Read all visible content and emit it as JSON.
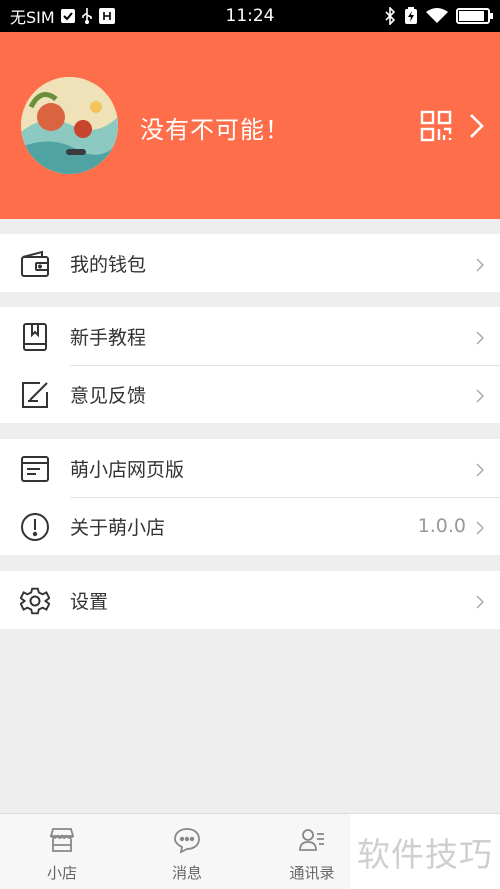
{
  "status_bar": {
    "carrier": "无SIM",
    "time": "11:24",
    "battery_level": 0.9
  },
  "profile": {
    "username": "没有不可能！",
    "qr_icon": "qr-code-icon",
    "chevron_icon": "chevron-right-icon"
  },
  "menu": {
    "wallet": {
      "label": "我的钱包",
      "icon": "wallet-icon"
    },
    "tutorial": {
      "label": "新手教程",
      "icon": "book-icon"
    },
    "feedback": {
      "label": "意见反馈",
      "icon": "edit-icon"
    },
    "web_version": {
      "label": "萌小店网页版",
      "icon": "browser-icon"
    },
    "about": {
      "label": "关于萌小店",
      "icon": "info-icon",
      "value": "1.0.0"
    },
    "settings": {
      "label": "设置",
      "icon": "gear-icon"
    }
  },
  "tabbar": {
    "shop": {
      "label": "小店",
      "icon": "shop-icon"
    },
    "messages": {
      "label": "消息",
      "icon": "chat-icon"
    },
    "contacts": {
      "label": "通讯录",
      "icon": "contacts-icon"
    }
  },
  "watermark": "软件技巧",
  "colors": {
    "header_bg": "#ff6e4a",
    "page_bg": "#eeeeee",
    "divider": "#e3e3e3"
  }
}
